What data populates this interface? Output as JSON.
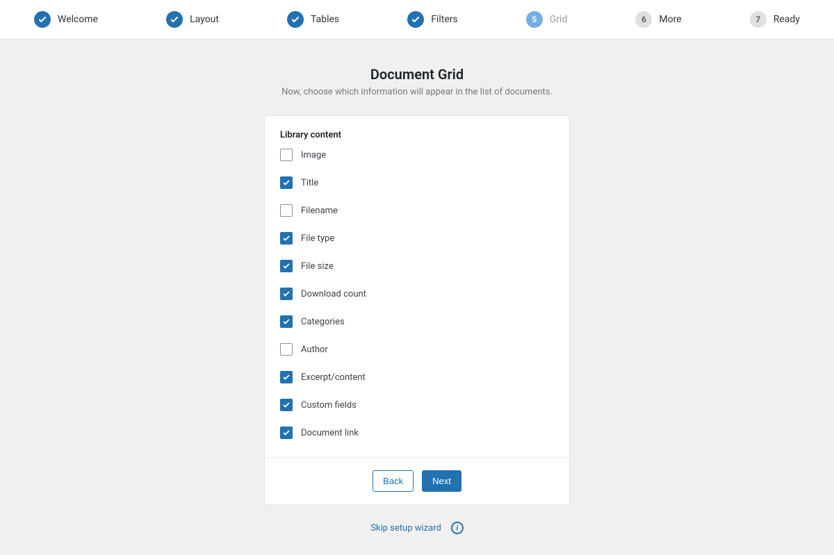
{
  "stepper": {
    "steps": [
      {
        "label": "Welcome",
        "state": "done"
      },
      {
        "label": "Layout",
        "state": "done"
      },
      {
        "label": "Tables",
        "state": "done"
      },
      {
        "label": "Filters",
        "state": "done"
      },
      {
        "label": "Grid",
        "state": "current",
        "number": "5"
      },
      {
        "label": "More",
        "state": "future",
        "number": "6"
      },
      {
        "label": "Ready",
        "state": "future",
        "number": "7"
      }
    ]
  },
  "header": {
    "title": "Document Grid",
    "subtitle": "Now, choose which information will appear in the list of documents."
  },
  "form": {
    "section_label": "Library content",
    "fields": [
      {
        "label": "Image",
        "checked": false
      },
      {
        "label": "Title",
        "checked": true
      },
      {
        "label": "Filename",
        "checked": false
      },
      {
        "label": "File type",
        "checked": true
      },
      {
        "label": "File size",
        "checked": true
      },
      {
        "label": "Download count",
        "checked": true
      },
      {
        "label": "Categories",
        "checked": true
      },
      {
        "label": "Author",
        "checked": false
      },
      {
        "label": "Excerpt/content",
        "checked": true
      },
      {
        "label": "Custom fields",
        "checked": true
      },
      {
        "label": "Document link",
        "checked": true
      }
    ]
  },
  "footer": {
    "back_label": "Back",
    "next_label": "Next"
  },
  "skip": {
    "label": "Skip setup wizard"
  }
}
